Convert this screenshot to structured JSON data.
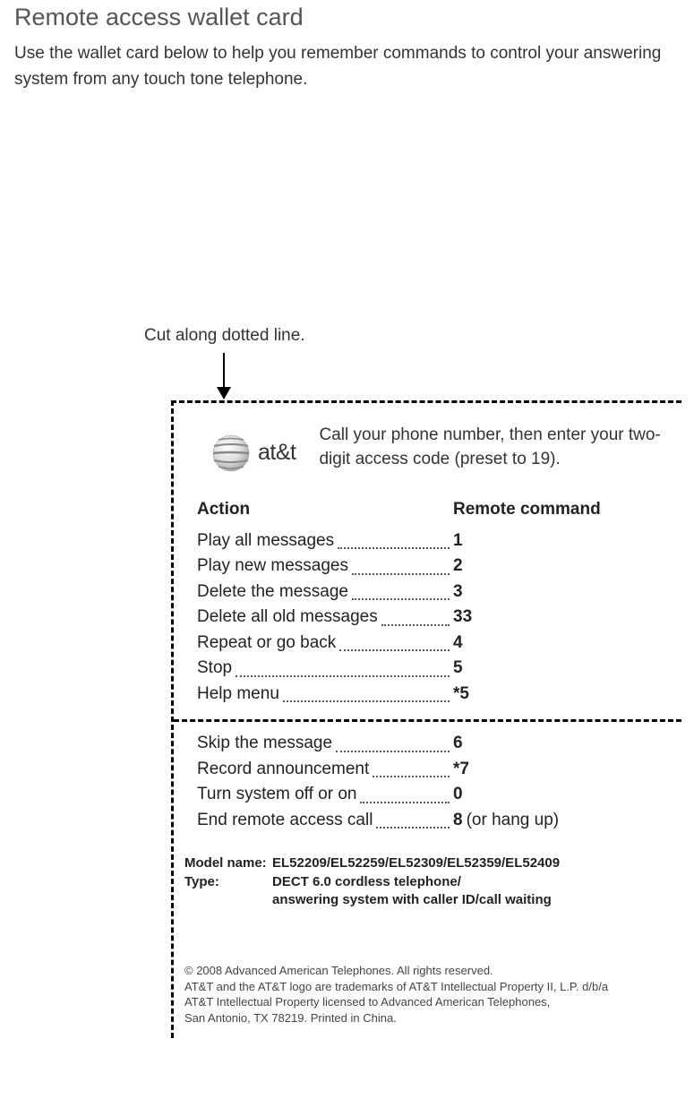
{
  "title": "Remote access wallet card",
  "intro": "Use the wallet card below to help you remember commands to control your answering system from any touch tone telephone.",
  "cut_label": "Cut along dotted line.",
  "logo_text": "at&t",
  "instruction": "Call your phone number, then enter your two-digit access code (preset to 19).",
  "header_action": "Action",
  "header_command": "Remote command",
  "group1": [
    {
      "action": "Play all messages",
      "code": "1",
      "extra": ""
    },
    {
      "action": "Play new messages",
      "code": "2",
      "extra": ""
    },
    {
      "action": "Delete the message",
      "code": "3",
      "extra": ""
    },
    {
      "action": "Delete all old messages",
      "code": "33",
      "extra": ""
    },
    {
      "action": "Repeat or go back",
      "code": "4",
      "extra": ""
    },
    {
      "action": "Stop",
      "code": "5",
      "extra": ""
    },
    {
      "action": "Help menu",
      "code": "*5",
      "extra": ""
    }
  ],
  "group2": [
    {
      "action": "Skip the message",
      "code": "6",
      "extra": ""
    },
    {
      "action": "Record announcement",
      "code": "*7",
      "extra": ""
    },
    {
      "action": "Turn system off or on",
      "code": "0",
      "extra": ""
    },
    {
      "action": "End remote access call",
      "code": "8",
      "extra": " (or hang up)"
    }
  ],
  "model_label": "Model name:",
  "model_value": "EL52209/EL52259/EL52309/EL52359/EL52409",
  "type_label": "Type:",
  "type_value1": "DECT 6.0 cordless telephone/",
  "type_value2": "answering system with caller ID/call waiting",
  "legal1": "© 2008 Advanced American Telephones. All rights reserved.",
  "legal2": "AT&T and the AT&T logo are trademarks of AT&T Intellectual Property II, L.P. d/b/a",
  "legal3": "AT&T Intellectual Property licensed to Advanced American Telephones,",
  "legal4": "San Antonio, TX 78219. Printed in China."
}
